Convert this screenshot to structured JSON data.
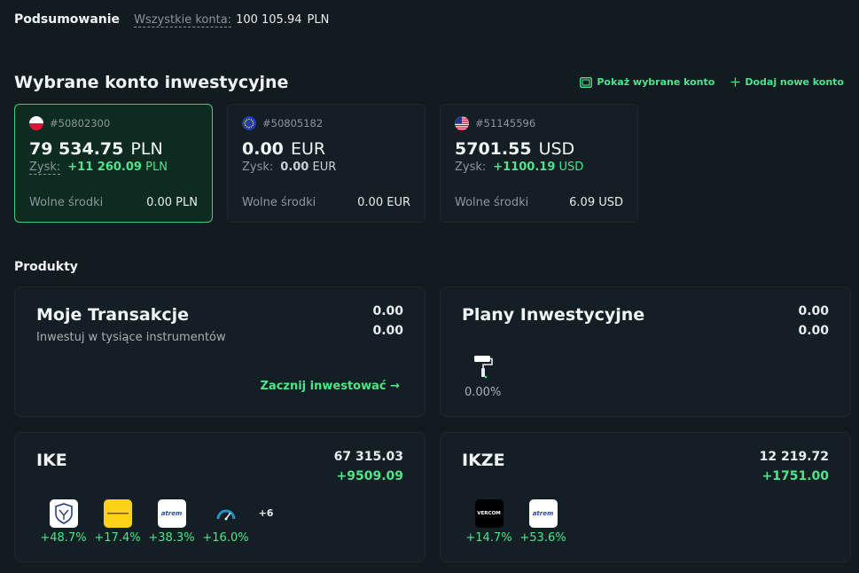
{
  "summary": {
    "title": "Podsumowanie",
    "all_accounts_label": "Wszystkie konta:",
    "all_accounts_value": "100 105.94",
    "currency": "PLN"
  },
  "investment": {
    "title": "Wybrane konto inwestycyjne",
    "show_selected_label": "Pokaż wybrane konto",
    "add_account_label": "Dodaj nowe konto",
    "accent_color": "#4fe38a"
  },
  "accounts": [
    {
      "flag": "poland-flag-icon",
      "number": "#50802300",
      "balance": "79 534.75",
      "currency": "PLN",
      "profit_label": "Zysk:",
      "profit_value": "+11 260.09",
      "profit_currency": "PLN",
      "free_label": "Wolne środki",
      "free_value": "0.00 PLN"
    },
    {
      "flag": "eu-flag-icon",
      "number": "#50805182",
      "balance": "0.00",
      "currency": "EUR",
      "profit_label": "Zysk:",
      "profit_value": "0.00",
      "profit_currency": "EUR",
      "free_label": "Wolne środki",
      "free_value": "0.00 EUR"
    },
    {
      "flag": "usa-flag-icon",
      "number": "#51145596",
      "balance": "5701.55",
      "currency": "USD",
      "profit_label": "Zysk:",
      "profit_value": "+1100.19",
      "profit_currency": "USD",
      "free_label": "Wolne środki",
      "free_value": "6.09 USD"
    }
  ],
  "products": {
    "title": "Produkty",
    "transactions": {
      "name": "Moje Transakcje",
      "subtitle": "Inwestuj w tysiące instrumentów",
      "value1": "0.00",
      "value2": "0.00",
      "cta": "Zacznij inwestować →"
    },
    "plans": {
      "name": "Plany Inwestycyjne",
      "value1": "0.00",
      "value2": "0.00",
      "percent": "0.00%"
    },
    "ike": {
      "name": "IKE",
      "value1": "67 315.03",
      "value2": "+9509.09",
      "logos": [
        {
          "icon": "shield-logo-icon",
          "pct": "+48.7%"
        },
        {
          "icon": "yellow-logo-icon",
          "pct": "+17.4%"
        },
        {
          "icon": "atrem-logo-icon",
          "text": "atrem",
          "pct": "+38.3%"
        },
        {
          "icon": "gauge-logo-icon",
          "pct": "+16.0%"
        }
      ],
      "more": "+6"
    },
    "ikze": {
      "name": "IKZE",
      "value1": "12 219.72",
      "value2": "+1751.00",
      "logos": [
        {
          "icon": "vercom-logo-icon",
          "text": "VERCOM",
          "pct": "+14.7%"
        },
        {
          "icon": "atrem-logo-icon",
          "text": "atrem",
          "pct": "+53.6%"
        }
      ]
    }
  }
}
